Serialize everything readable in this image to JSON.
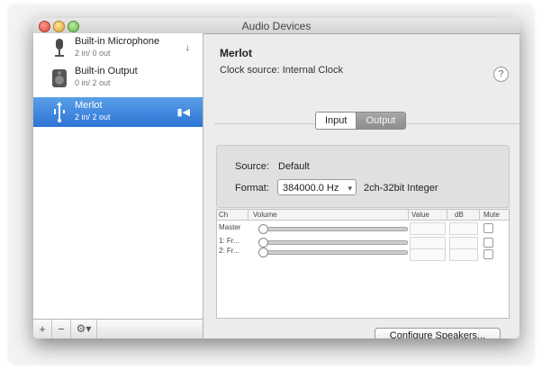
{
  "window": {
    "title": "Audio Devices"
  },
  "devices": [
    {
      "name": "Built-in Microphone",
      "io": "2 in/ 0 out",
      "icon": "microphone-icon",
      "badge": "↓"
    },
    {
      "name": "Built-in Output",
      "io": "0 in/ 2 out",
      "icon": "speaker-icon",
      "badge": ""
    },
    {
      "name": "Merlot",
      "io": "2 in/ 2 out",
      "icon": "usb-icon",
      "badge": "▮◀"
    }
  ],
  "selected_device": "Merlot",
  "toolbar": {
    "add": "+",
    "remove": "−",
    "gear": "⚙▾"
  },
  "detail": {
    "title": "Merlot",
    "clock_source": "Clock source: Internal Clock",
    "help": "?",
    "tabs": [
      "Input",
      "Output"
    ],
    "active_tab": "Input",
    "source_label": "Source:",
    "source_value": "Default",
    "format_label": "Format:",
    "format_rate": "384000.0 Hz",
    "format_bits": "2ch-32bit Integer",
    "table": {
      "headers": [
        "Ch",
        "Volume",
        "Value",
        "dB",
        "Mute"
      ],
      "rows": [
        {
          "label": "Master"
        },
        {
          "label": "1: Fr..."
        },
        {
          "label": "2: Fr..."
        }
      ]
    },
    "configure_button": "Configure Speakers..."
  }
}
